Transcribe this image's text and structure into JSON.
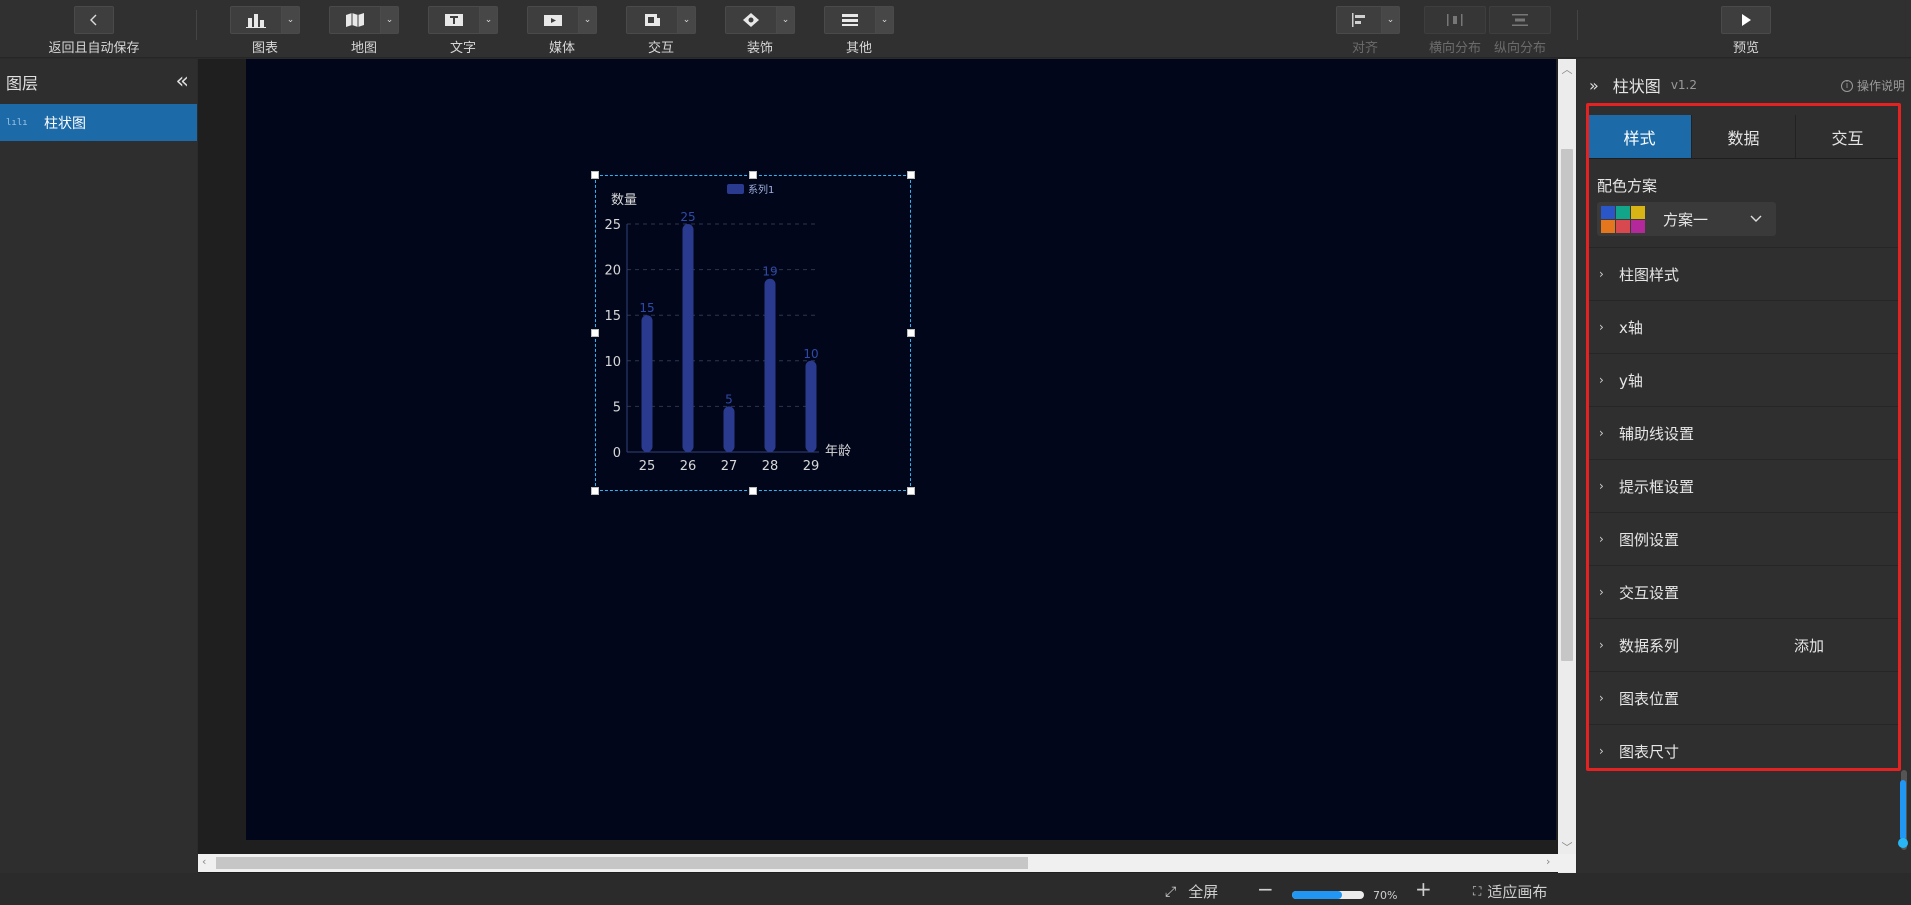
{
  "toolbar": {
    "back_label": "返回且自动保存",
    "tools": [
      {
        "label": "图表",
        "icon": "bar-chart-icon"
      },
      {
        "label": "地图",
        "icon": "map-icon"
      },
      {
        "label": "文字",
        "icon": "text-icon"
      },
      {
        "label": "媒体",
        "icon": "media-icon"
      },
      {
        "label": "交互",
        "icon": "interaction-icon"
      },
      {
        "label": "装饰",
        "icon": "decoration-icon"
      },
      {
        "label": "其他",
        "icon": "other-icon"
      }
    ],
    "align_label": "对齐",
    "hdist_label": "横向分布",
    "vdist_label": "纵向分布",
    "preview_label": "预览"
  },
  "layers": {
    "title": "图层",
    "items": [
      {
        "label": "柱状图",
        "icon_text": "lılı"
      }
    ]
  },
  "chart_data": {
    "type": "bar",
    "categories": [
      "25",
      "26",
      "27",
      "28",
      "29"
    ],
    "series": [
      {
        "name": "系列1",
        "values": [
          15,
          25,
          5,
          19,
          10
        ]
      }
    ],
    "ylabel": "数量",
    "xlabel": "年龄",
    "ylim": [
      0,
      25
    ],
    "yticks": [
      0,
      5,
      10,
      15,
      20,
      25
    ],
    "legend": "top-center",
    "grid": true,
    "color": "#2a3a8f",
    "label_color": "#2f4aa8"
  },
  "props": {
    "title": "柱状图",
    "version": "v1.2",
    "help_label": "操作说明",
    "tabs": [
      {
        "label": "样式",
        "active": true
      },
      {
        "label": "数据",
        "active": false
      },
      {
        "label": "交互",
        "active": false
      }
    ],
    "color_scheme": {
      "label": "配色方案",
      "value": "方案一",
      "swatches": [
        "#2b56c7",
        "#12a58a",
        "#d8b515",
        "#e4771e",
        "#d8484f",
        "#b3299b"
      ]
    },
    "sections": [
      {
        "label": "柱图样式"
      },
      {
        "label": "x轴"
      },
      {
        "label": "y轴"
      },
      {
        "label": "辅助线设置"
      },
      {
        "label": "提示框设置"
      },
      {
        "label": "图例设置"
      },
      {
        "label": "交互设置"
      },
      {
        "label": "数据系列",
        "extra": "添加"
      },
      {
        "label": "图表位置"
      },
      {
        "label": "图表尺寸"
      }
    ]
  },
  "statusbar": {
    "fullscreen_label": "全屏",
    "zoom_percent": "70%",
    "zoom_level": 0.7,
    "fit_label": "适应画布"
  },
  "colors": {
    "accent": "#1c6aa8",
    "highlight_frame": "#e52222",
    "canvas_bg": "#01061a",
    "selection": "#29b6f6"
  }
}
